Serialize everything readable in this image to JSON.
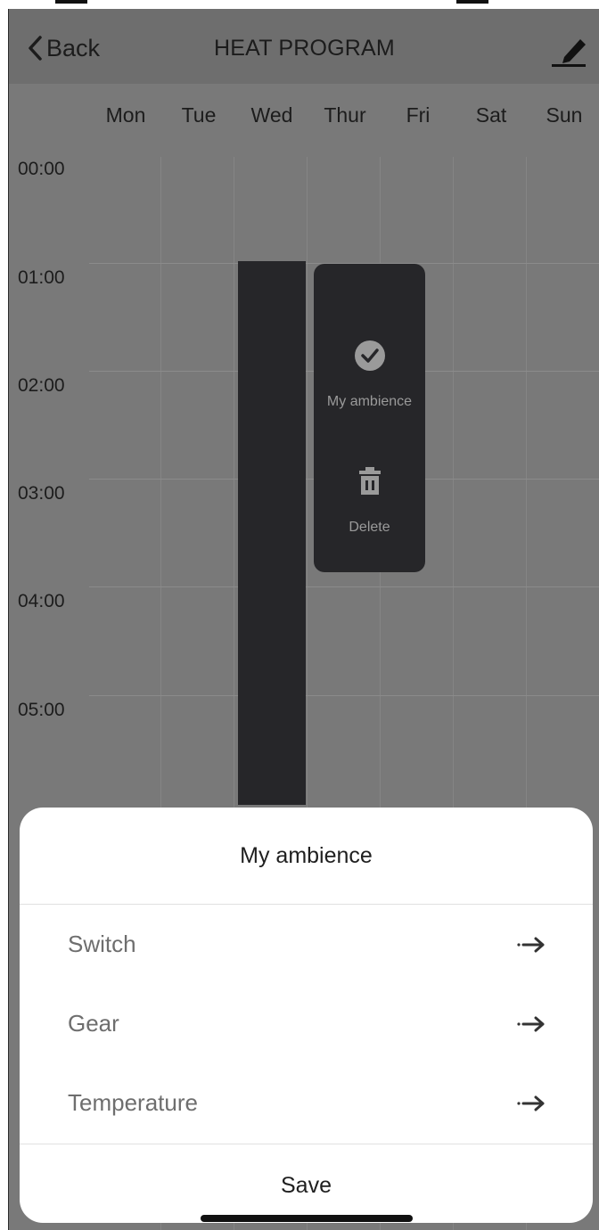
{
  "header": {
    "back_label": "Back",
    "title": "HEAT PROGRAM"
  },
  "days": [
    "Mon",
    "Tue",
    "Wed",
    "Thur",
    "Fri",
    "Sat",
    "Sun"
  ],
  "times": [
    "00:00",
    "01:00",
    "02:00",
    "03:00",
    "04:00",
    "05:00"
  ],
  "popup": {
    "ambience_label": "My ambience",
    "delete_label": "Delete"
  },
  "sheet": {
    "title": "My ambience",
    "rows": [
      {
        "label": "Switch"
      },
      {
        "label": "Gear"
      },
      {
        "label": "Temperature"
      }
    ],
    "save_label": "Save"
  },
  "colors": {
    "overlay": "#797979",
    "block": "#262629",
    "sheet": "#ffffff"
  }
}
